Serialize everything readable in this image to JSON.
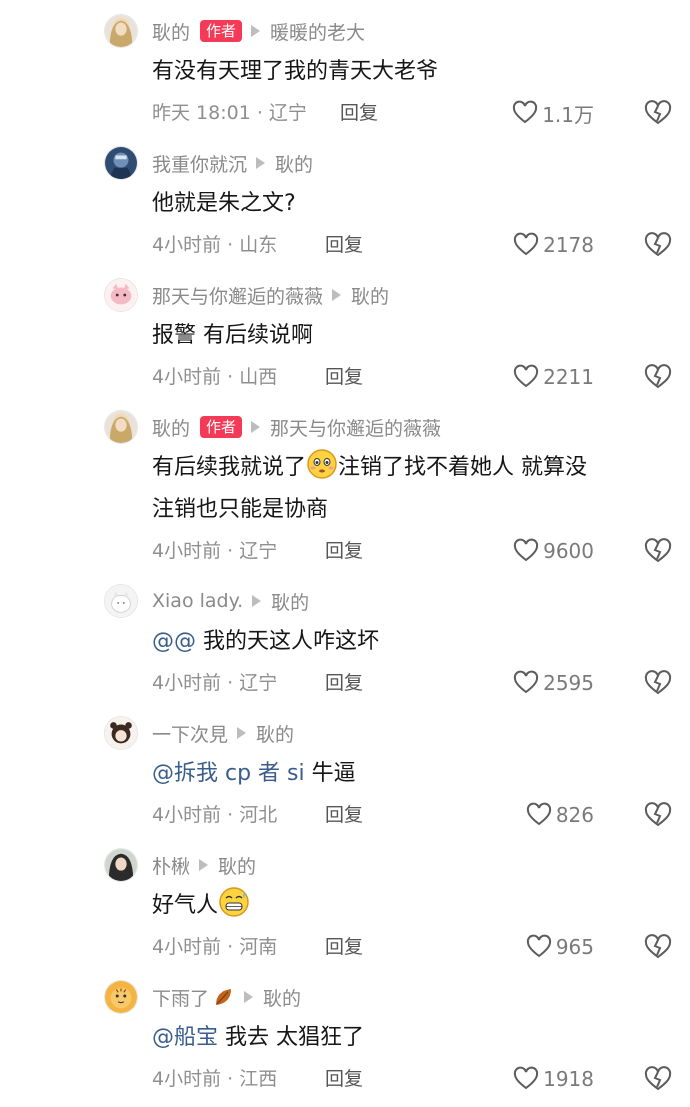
{
  "comments": [
    {
      "author": "耿的",
      "author_badge": "作者",
      "reply_to": "暖暖的老大",
      "text": "有没有天理了我的青天大老爷",
      "time_location": "昨天 18:01 · 辽宁",
      "reply_label": "回复",
      "likes": "1.1万",
      "avatar": "avatar-girl-blonde"
    },
    {
      "author": "我重你就沉",
      "reply_to": "耿的",
      "text": "他就是朱之文?",
      "time_location": "4小时前 · 山东",
      "reply_label": "回复",
      "likes": "2178",
      "avatar": "avatar-anime-blue"
    },
    {
      "author": "那天与你邂逅的薇薇",
      "reply_to": "耿的",
      "text": "报警 有后续说啊",
      "time_location": "4小时前 · 山西",
      "reply_label": "回复",
      "likes": "2211",
      "avatar": "avatar-pink-cartoon"
    },
    {
      "author": "耿的",
      "author_badge": "作者",
      "reply_to": "那天与你邂逅的薇薇",
      "text_line1_a": "有后续我就说了",
      "text_line1_b": "注销了找不着她人 就算没",
      "text_line2": "注销也只能是协商",
      "time_location": "4小时前 · 辽宁",
      "reply_label": "回复",
      "likes": "9600",
      "avatar": "avatar-girl-blonde"
    },
    {
      "author": "Xiao lady.",
      "reply_to": "耿的",
      "mention": "@@",
      "text": "我的天这人咋这坏",
      "time_location": "4小时前 · 辽宁",
      "reply_label": "回复",
      "likes": "2595",
      "avatar": "avatar-white-cat"
    },
    {
      "author": "一下次見",
      "reply_to": "耿的",
      "mention": "@拆我 cp 者 si",
      "text": "牛逼",
      "time_location": "4小时前 · 河北",
      "reply_label": "回复",
      "likes": "826",
      "avatar": "avatar-girl-bear"
    },
    {
      "author": "朴楸",
      "reply_to": "耿的",
      "text": "好气人",
      "time_location": "4小时前 · 河南",
      "reply_label": "回复",
      "likes": "965",
      "avatar": "avatar-girl-dark"
    },
    {
      "author": "下雨了",
      "reply_to": "耿的",
      "mention": "@船宝",
      "text": "我去 太猖狂了",
      "time_location": "4小时前 · 江西",
      "reply_label": "回复",
      "likes": "1918",
      "avatar": "avatar-tiger"
    }
  ],
  "colors": {
    "badge": "#f43a57",
    "mention": "#3a5e8c",
    "meta": "#8a8a8a"
  }
}
